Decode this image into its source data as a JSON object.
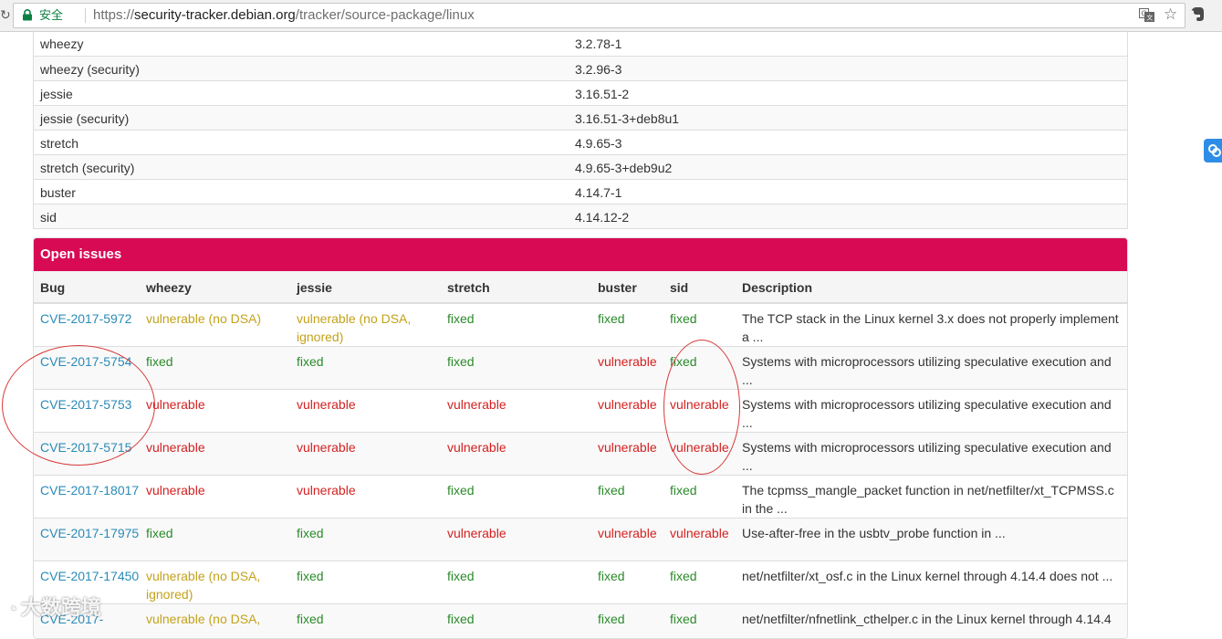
{
  "browser": {
    "secure_label": "安全",
    "url_scheme": "https://",
    "url_host": "security-tracker.debian.org",
    "url_path": "/tracker/source-package/linux"
  },
  "suites": [
    {
      "name": "wheezy",
      "version": "3.2.78-1"
    },
    {
      "name": "wheezy (security)",
      "version": "3.2.96-3"
    },
    {
      "name": "jessie",
      "version": "3.16.51-2"
    },
    {
      "name": "jessie (security)",
      "version": "3.16.51-3+deb8u1"
    },
    {
      "name": "stretch",
      "version": "4.9.65-3"
    },
    {
      "name": "stretch (security)",
      "version": "4.9.65-3+deb9u2"
    },
    {
      "name": "buster",
      "version": "4.14.7-1"
    },
    {
      "name": "sid",
      "version": "4.14.12-2"
    }
  ],
  "open_issues": {
    "title": "Open issues",
    "columns": [
      "Bug",
      "wheezy",
      "jessie",
      "stretch",
      "buster",
      "sid",
      "Description"
    ],
    "rows": [
      {
        "bug": "CVE-2017-5972",
        "wheezy": "vulnerable (no DSA)",
        "jessie": "vulnerable (no DSA, ignored)",
        "stretch": "fixed",
        "buster": "fixed",
        "sid": "fixed",
        "description": "The TCP stack in the Linux kernel 3.x does not properly implement a ..."
      },
      {
        "bug": "CVE-2017-5754",
        "wheezy": "fixed",
        "jessie": "fixed",
        "stretch": "fixed",
        "buster": "vulnerable",
        "sid": "fixed",
        "description": "Systems with microprocessors utilizing speculative execution and ..."
      },
      {
        "bug": "CVE-2017-5753",
        "wheezy": "vulnerable",
        "jessie": "vulnerable",
        "stretch": "vulnerable",
        "buster": "vulnerable",
        "sid": "vulnerable",
        "description": "Systems with microprocessors utilizing speculative execution and ..."
      },
      {
        "bug": "CVE-2017-5715",
        "wheezy": "vulnerable",
        "jessie": "vulnerable",
        "stretch": "vulnerable",
        "buster": "vulnerable",
        "sid": "vulnerable",
        "description": "Systems with microprocessors utilizing speculative execution and ..."
      },
      {
        "bug": "CVE-2017-18017",
        "wheezy": "vulnerable",
        "jessie": "vulnerable",
        "stretch": "fixed",
        "buster": "fixed",
        "sid": "fixed",
        "description": "The tcpmss_mangle_packet function in net/netfilter/xt_TCPMSS.c in the ..."
      },
      {
        "bug": "CVE-2017-17975",
        "wheezy": "fixed",
        "jessie": "fixed",
        "stretch": "vulnerable",
        "buster": "vulnerable",
        "sid": "vulnerable",
        "description": "Use-after-free in the usbtv_probe function in ..."
      },
      {
        "bug": "CVE-2017-17450",
        "wheezy": "vulnerable (no DSA, ignored)",
        "jessie": "fixed",
        "stretch": "fixed",
        "buster": "fixed",
        "sid": "fixed",
        "description": "net/netfilter/xt_osf.c in the Linux kernel through 4.14.4 does not ..."
      },
      {
        "bug": "CVE-2017-",
        "wheezy": "vulnerable (no DSA,",
        "jessie": "fixed",
        "stretch": "fixed",
        "buster": "fixed",
        "sid": "fixed",
        "description": "net/netfilter/nfnetlink_cthelper.c in the Linux kernel through 4.14.4"
      }
    ]
  },
  "status_colors": {
    "fixed": "#2a8a2a",
    "vulnerable": "#d42020",
    "vulnerable_no_dsa": "#c4a21a",
    "link": "#2a8bb7",
    "panel_header": "#d70a53"
  },
  "watermark": "大数跨境",
  "icons": [
    "lock-icon",
    "translate-icon",
    "star-icon",
    "evernote-icon",
    "link-icon"
  ]
}
